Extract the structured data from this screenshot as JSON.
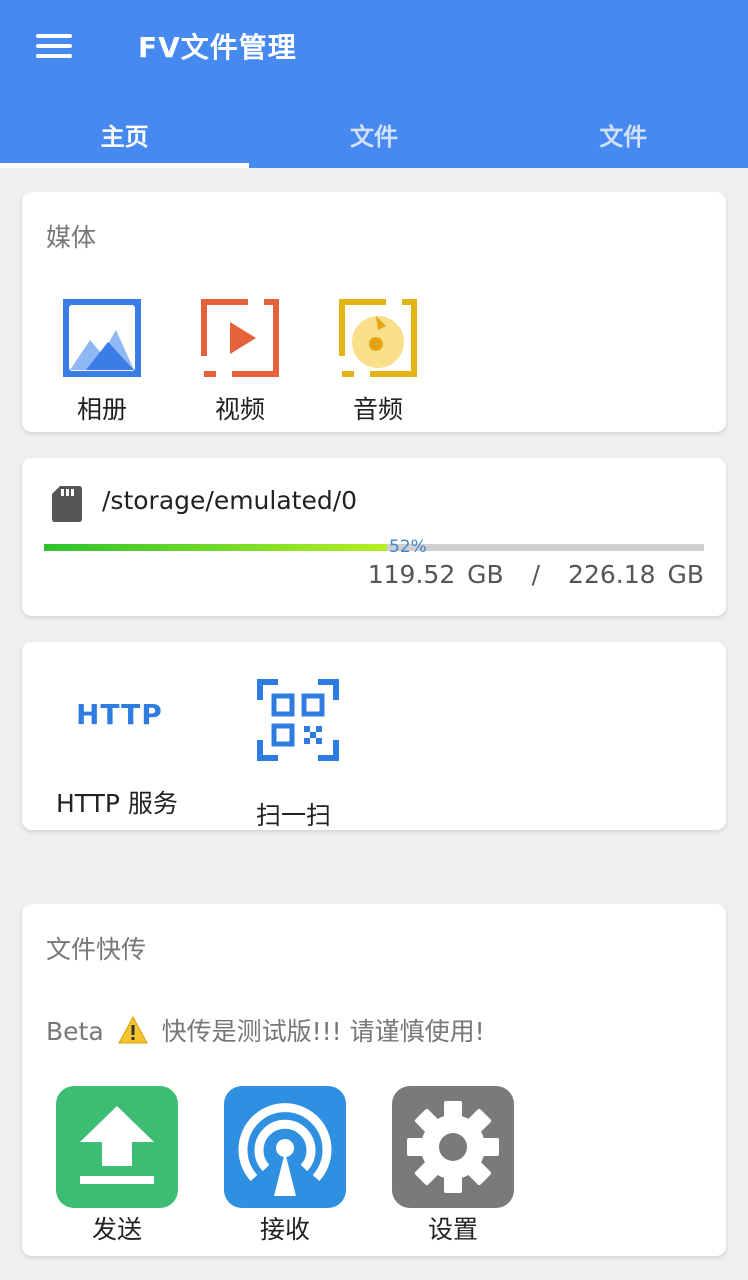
{
  "app": {
    "title": "FV文件管理"
  },
  "tabs": [
    {
      "label": "主页",
      "active": true
    },
    {
      "label": "文件",
      "active": false
    },
    {
      "label": "文件",
      "active": false
    }
  ],
  "media": {
    "title": "媒体",
    "items": [
      {
        "label": "相册",
        "icon": "photo-album-icon"
      },
      {
        "label": "视频",
        "icon": "video-icon"
      },
      {
        "label": "音频",
        "icon": "audio-icon"
      }
    ]
  },
  "storage": {
    "path": "/storage/emulated/0",
    "percent_label": "52%",
    "percent": 52,
    "used": "119.52 GB",
    "separator": "/",
    "total": "226.18 GB"
  },
  "tools": {
    "http_label": "HTTP 服务",
    "http_icon_text": "HTTP",
    "scan_label": "扫一扫"
  },
  "transfer": {
    "title": "文件快传",
    "beta_prefix": "Beta",
    "beta_text": "快传是测试版!!! 请谨慎使用!",
    "send_label": "发送",
    "receive_label": "接收",
    "settings_label": "设置"
  },
  "colors": {
    "appbar": "#4689f0",
    "send": "#3dbd74",
    "receive": "#2f8fe0",
    "settings": "#7a7a7a"
  }
}
